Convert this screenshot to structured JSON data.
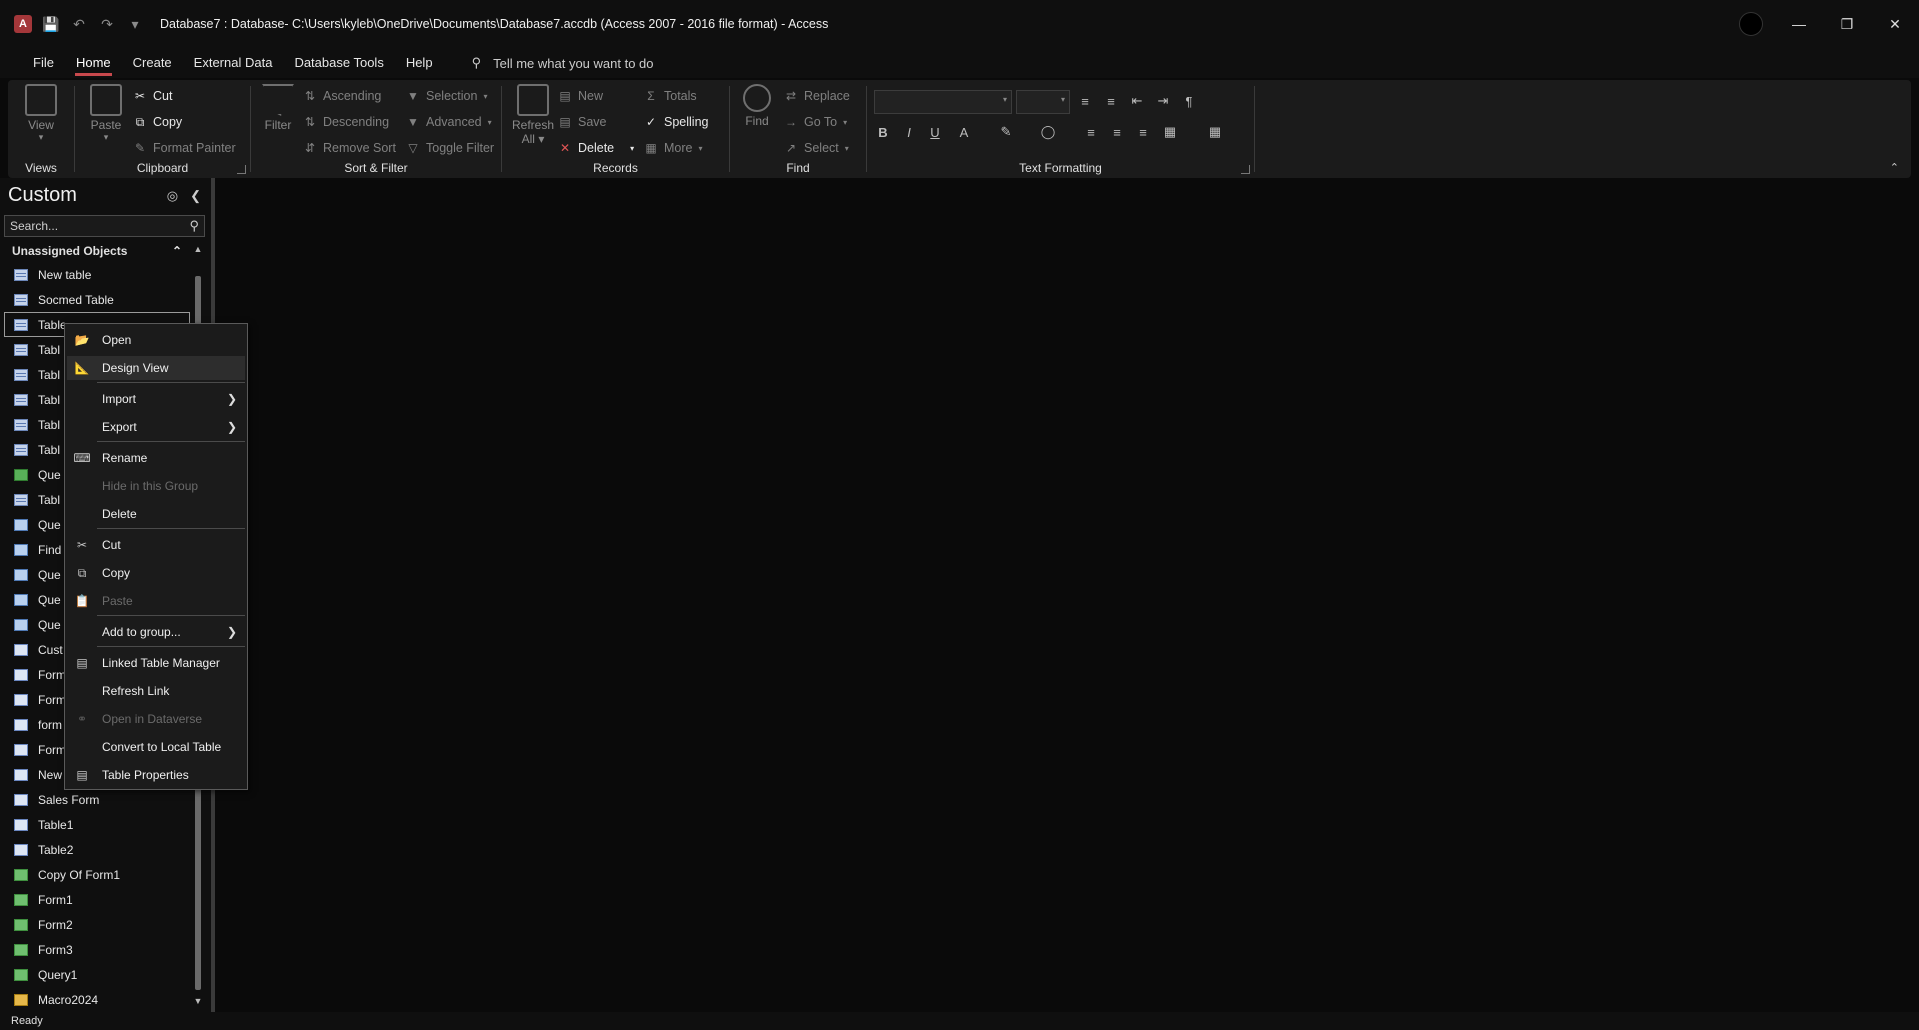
{
  "title_bar": {
    "title": "Database7 : Database- C:\\Users\\kyleb\\OneDrive\\Documents\\Database7.accdb (Access 2007 - 2016 file format)  -  Access"
  },
  "menu_tabs": [
    "File",
    "Home",
    "Create",
    "External Data",
    "Database Tools",
    "Help"
  ],
  "active_tab": "Home",
  "tell_me": {
    "placeholder": "Tell me what you want to do"
  },
  "ribbon": {
    "views": {
      "label": "Views",
      "view": "View"
    },
    "clipboard": {
      "label": "Clipboard",
      "paste": "Paste",
      "cut": "Cut",
      "copy": "Copy",
      "format_painter": "Format Painter"
    },
    "sort_filter": {
      "label": "Sort & Filter",
      "filter": "Filter",
      "ascending": "Ascending",
      "descending": "Descending",
      "remove_sort": "Remove Sort",
      "selection": "Selection",
      "advanced": "Advanced",
      "toggle_filter": "Toggle Filter"
    },
    "records": {
      "label": "Records",
      "refresh_all_1": "Refresh",
      "refresh_all_2": "All",
      "new": "New",
      "save": "Save",
      "delete": "Delete",
      "totals": "Totals",
      "spelling": "Spelling",
      "more": "More"
    },
    "find": {
      "label": "Find",
      "find": "Find",
      "replace": "Replace",
      "go_to": "Go To",
      "select": "Select"
    },
    "text_formatting": {
      "label": "Text Formatting",
      "bold": "B",
      "italic": "I",
      "underline": "U"
    }
  },
  "nav_pane": {
    "title": "Custom",
    "search_placeholder": "Search...",
    "group_header": "Unassigned Objects",
    "items": [
      {
        "label": "New table",
        "type": "table"
      },
      {
        "label": "Socmed Table",
        "type": "table"
      },
      {
        "label": "Table",
        "type": "table"
      },
      {
        "label": "Tabl",
        "type": "table"
      },
      {
        "label": "Tabl",
        "type": "table"
      },
      {
        "label": "Tabl",
        "type": "table"
      },
      {
        "label": "Tabl",
        "type": "table"
      },
      {
        "label": "Tabl",
        "type": "table"
      },
      {
        "label": "Que",
        "type": "append"
      },
      {
        "label": "Tabl",
        "type": "table"
      },
      {
        "label": "Que",
        "type": "query"
      },
      {
        "label": "Find",
        "type": "query"
      },
      {
        "label": "Que",
        "type": "query"
      },
      {
        "label": "Que",
        "type": "query"
      },
      {
        "label": "Que",
        "type": "query"
      },
      {
        "label": "Cust",
        "type": "form"
      },
      {
        "label": "Form",
        "type": "form"
      },
      {
        "label": "Form",
        "type": "form"
      },
      {
        "label": "form",
        "type": "form"
      },
      {
        "label": "Form",
        "type": "form"
      },
      {
        "label": "New",
        "type": "form"
      },
      {
        "label": "Sales Form",
        "type": "form"
      },
      {
        "label": "Table1",
        "type": "form"
      },
      {
        "label": "Table2",
        "type": "form"
      },
      {
        "label": "Copy Of Form1",
        "type": "report"
      },
      {
        "label": "Form1",
        "type": "report"
      },
      {
        "label": "Form2",
        "type": "report"
      },
      {
        "label": "Form3",
        "type": "report"
      },
      {
        "label": "Query1",
        "type": "report"
      },
      {
        "label": "Macro2024",
        "type": "macro"
      }
    ]
  },
  "context_menu": {
    "open": "Open",
    "design_view": "Design View",
    "import": "Import",
    "export": "Export",
    "rename": "Rename",
    "hide_in_group": "Hide in this Group",
    "delete": "Delete",
    "cut": "Cut",
    "copy": "Copy",
    "paste": "Paste",
    "add_to_group": "Add to group...",
    "linked_table_manager": "Linked Table Manager",
    "refresh_link": "Refresh Link",
    "open_in_dataverse": "Open in Dataverse",
    "convert_to_local": "Convert to Local Table",
    "table_properties": "Table Properties"
  },
  "status_bar": {
    "text": "Ready"
  },
  "colors": {
    "accent": "#c8494d",
    "background": "#0a0a0a",
    "ribbon": "#1b1b1b"
  }
}
